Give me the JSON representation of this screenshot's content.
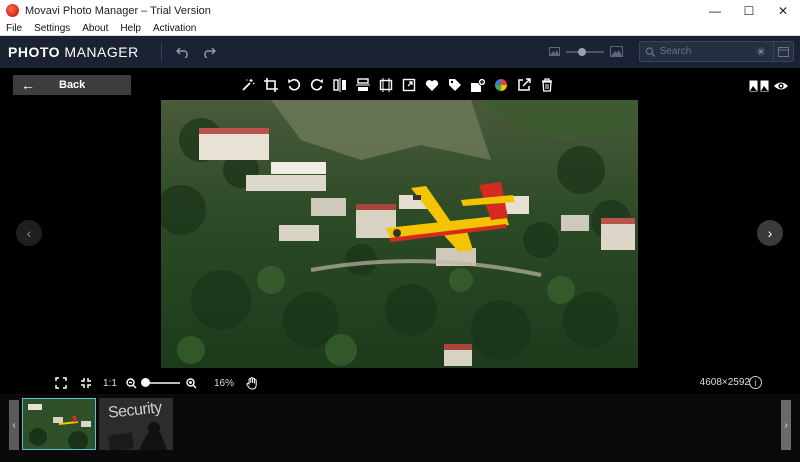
{
  "window": {
    "title": "Movavi Photo Manager – Trial Version",
    "controls": [
      "—",
      "☐",
      "✕"
    ]
  },
  "menu": [
    "File",
    "Settings",
    "About",
    "Help",
    "Activation"
  ],
  "header": {
    "brand_bold": "PHOTO",
    "brand_light": " MANAGER",
    "search_placeholder": "Search"
  },
  "viewer": {
    "back_label": "Back",
    "toolbar_icons": [
      "magic-wand-icon",
      "crop-icon",
      "rotate-left-icon",
      "rotate-right-icon",
      "flip-horizontal-icon",
      "flip-vertical-icon",
      "straighten-icon",
      "resize-icon",
      "heart-icon",
      "tag-icon",
      "add-to-album-icon",
      "color-icon",
      "share-icon",
      "delete-icon"
    ]
  },
  "zoom": {
    "fit_label": "1:1",
    "percent": "16%",
    "dimensions": "4608×2592",
    "info": "i"
  },
  "filmstrip": {
    "thumb2_text": "Security"
  },
  "colors": {
    "header_bg": "#1b2233",
    "accent": "#5bbfd6",
    "airplane": "#f5c400"
  }
}
